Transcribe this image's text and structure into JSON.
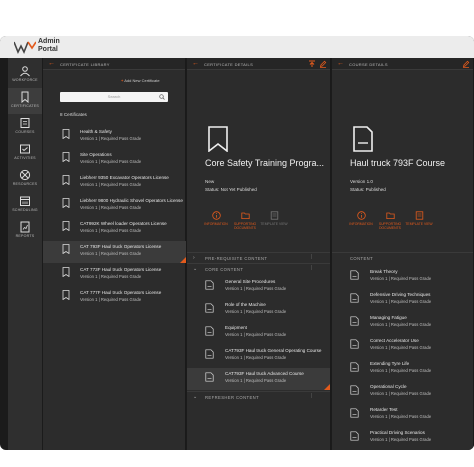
{
  "app": {
    "logo_line1": "Admin",
    "logo_line2": "Portal"
  },
  "nav": [
    {
      "label": "WORKFORCE",
      "icon": "workforce-icon"
    },
    {
      "label": "CERTIFICATES",
      "icon": "certificate-icon"
    },
    {
      "label": "COURSES",
      "icon": "courses-icon"
    },
    {
      "label": "ACTIVITIES",
      "icon": "activities-icon"
    },
    {
      "label": "RESOURCES",
      "icon": "resources-icon"
    },
    {
      "label": "SCHEDULING",
      "icon": "calendar-icon"
    },
    {
      "label": "REPORTS",
      "icon": "reports-icon"
    }
  ],
  "library": {
    "title": "CERTIFICATE LIBRARY",
    "add_label": "Add New Certificate",
    "search_placeholder": "Search",
    "count_label": "8 Certificates",
    "items": [
      {
        "name": "Health & Safety",
        "sub": "Version 1  |  Required Pass Grade"
      },
      {
        "name": "Site Operations",
        "sub": "Version 1  |  Required Pass Grade"
      },
      {
        "name": "Liebherr 9350 Excavator Operators License",
        "sub": "Version 1  |  Required Pass Grade"
      },
      {
        "name": "Liebherr 9800 Hydraulic Shovel Operators License",
        "sub": "Version 1  |  Required Pass Grade"
      },
      {
        "name": "CAT992K Wheel loader Operators License",
        "sub": "Version 1  |  Required Pass Grade"
      },
      {
        "name": "CAT 793F Haul truck Operators License",
        "sub": "Version 1  |  Required Pass Grade"
      },
      {
        "name": "CAT 773F Haul truck Operators License",
        "sub": "Version 1  |  Required Pass Grade"
      },
      {
        "name": "CAT 777F Haul truck Operators License",
        "sub": "Version 1  |  Required Pass Grade"
      }
    ]
  },
  "cert_details": {
    "title": "CERTIFICATE DETAILS",
    "name": "Core Safety Training Progra...",
    "version": "New",
    "status": "Status: Not Yet Published",
    "actions": [
      "INFORMATION",
      "SUPPORTING DOCUMENTS",
      "TEMPLATE VIEW"
    ],
    "sections": {
      "prereq": "PRE-REQUISITE CONTENT",
      "core": "CORE CONTENT",
      "refresher": "REFRESHER CONTENT"
    },
    "courses": [
      {
        "name": "General Site Procedures",
        "sub": "Version 1  |  Required Pass Grade"
      },
      {
        "name": "Role of the Machine",
        "sub": "Version 1  |  Required Pass Grade"
      },
      {
        "name": "Equipment",
        "sub": "Version 1  |  Required Pass Grade"
      },
      {
        "name": "CAT793F Haul truck General Operating Course",
        "sub": "Version 1  |  Required Pass Grade"
      },
      {
        "name": "CAT793F Haul truck Advanced Course",
        "sub": "Version 1  |  Required Pass Grade"
      }
    ]
  },
  "course_details": {
    "title": "COURSE DETAILS",
    "name": "Haul truck 793F Course",
    "version": "Version 1.0",
    "status": "Status: Published",
    "actions": [
      "INFORMATION",
      "SUPPORTING DOCUMENTS",
      "TEMPLATE VIEW"
    ],
    "content_label": "CONTENT",
    "items": [
      {
        "name": "Break Theory",
        "sub": "Version 1  |  Required Pass Grade"
      },
      {
        "name": "Defensive Driving Techniques",
        "sub": "Version 1  |  Required Pass Grade"
      },
      {
        "name": "Managing Fatigue",
        "sub": "Version 1  |  Required Pass Grade"
      },
      {
        "name": "Correct Accelerator Use",
        "sub": "Version 1  |  Required Pass Grade"
      },
      {
        "name": "Extending Tyre Life",
        "sub": "Version 1  |  Required Pass Grade"
      },
      {
        "name": "Operational Cycle",
        "sub": "Version 1  |  Required Pass Grade"
      },
      {
        "name": "Retarder Test",
        "sub": "Version 1  |  Required Pass Grade"
      },
      {
        "name": "Practical Driving Scenarios",
        "sub": "Version 1  |  Required Pass Grade"
      }
    ]
  },
  "colors": {
    "accent": "#e25a1c",
    "panel": "#2c2c2c",
    "background": "#1b1b1b"
  }
}
